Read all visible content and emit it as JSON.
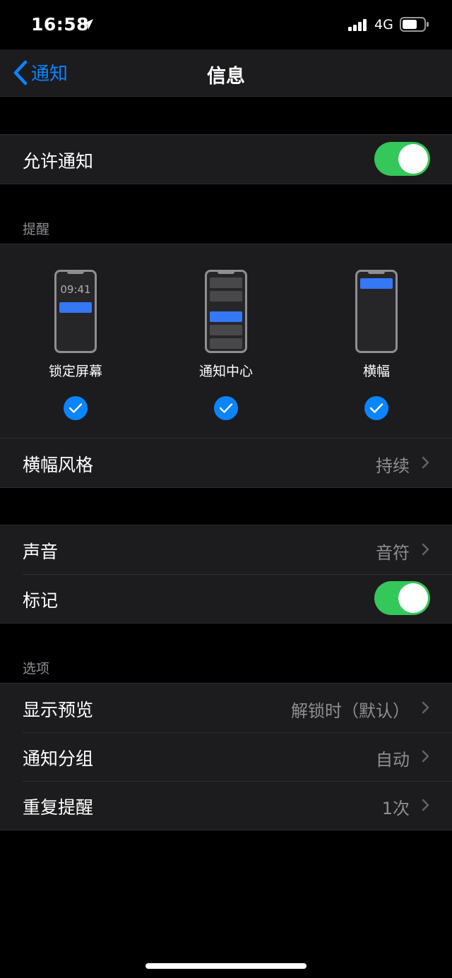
{
  "status": {
    "time": "16:58",
    "network": "4G"
  },
  "nav": {
    "back_label": "通知",
    "title": "信息"
  },
  "allow": {
    "label": "允许通知",
    "on": true
  },
  "alerts": {
    "header": "提醒",
    "options": [
      {
        "label": "锁定屏幕",
        "clock": "09:41",
        "checked": true
      },
      {
        "label": "通知中心",
        "checked": true
      },
      {
        "label": "横幅",
        "checked": true
      }
    ],
    "banner_style": {
      "label": "横幅风格",
      "value": "持续"
    }
  },
  "sounds": {
    "label": "声音",
    "value": "音符"
  },
  "badges": {
    "label": "标记",
    "on": true
  },
  "options": {
    "header": "选项",
    "rows": [
      {
        "label": "显示预览",
        "value": "解锁时（默认）"
      },
      {
        "label": "通知分组",
        "value": "自动"
      },
      {
        "label": "重复提醒",
        "value": "1次"
      }
    ]
  },
  "colors": {
    "accent": "#0a84ff",
    "toggle_on": "#34c759",
    "background": "#000000",
    "cell": "#1c1c1e"
  }
}
